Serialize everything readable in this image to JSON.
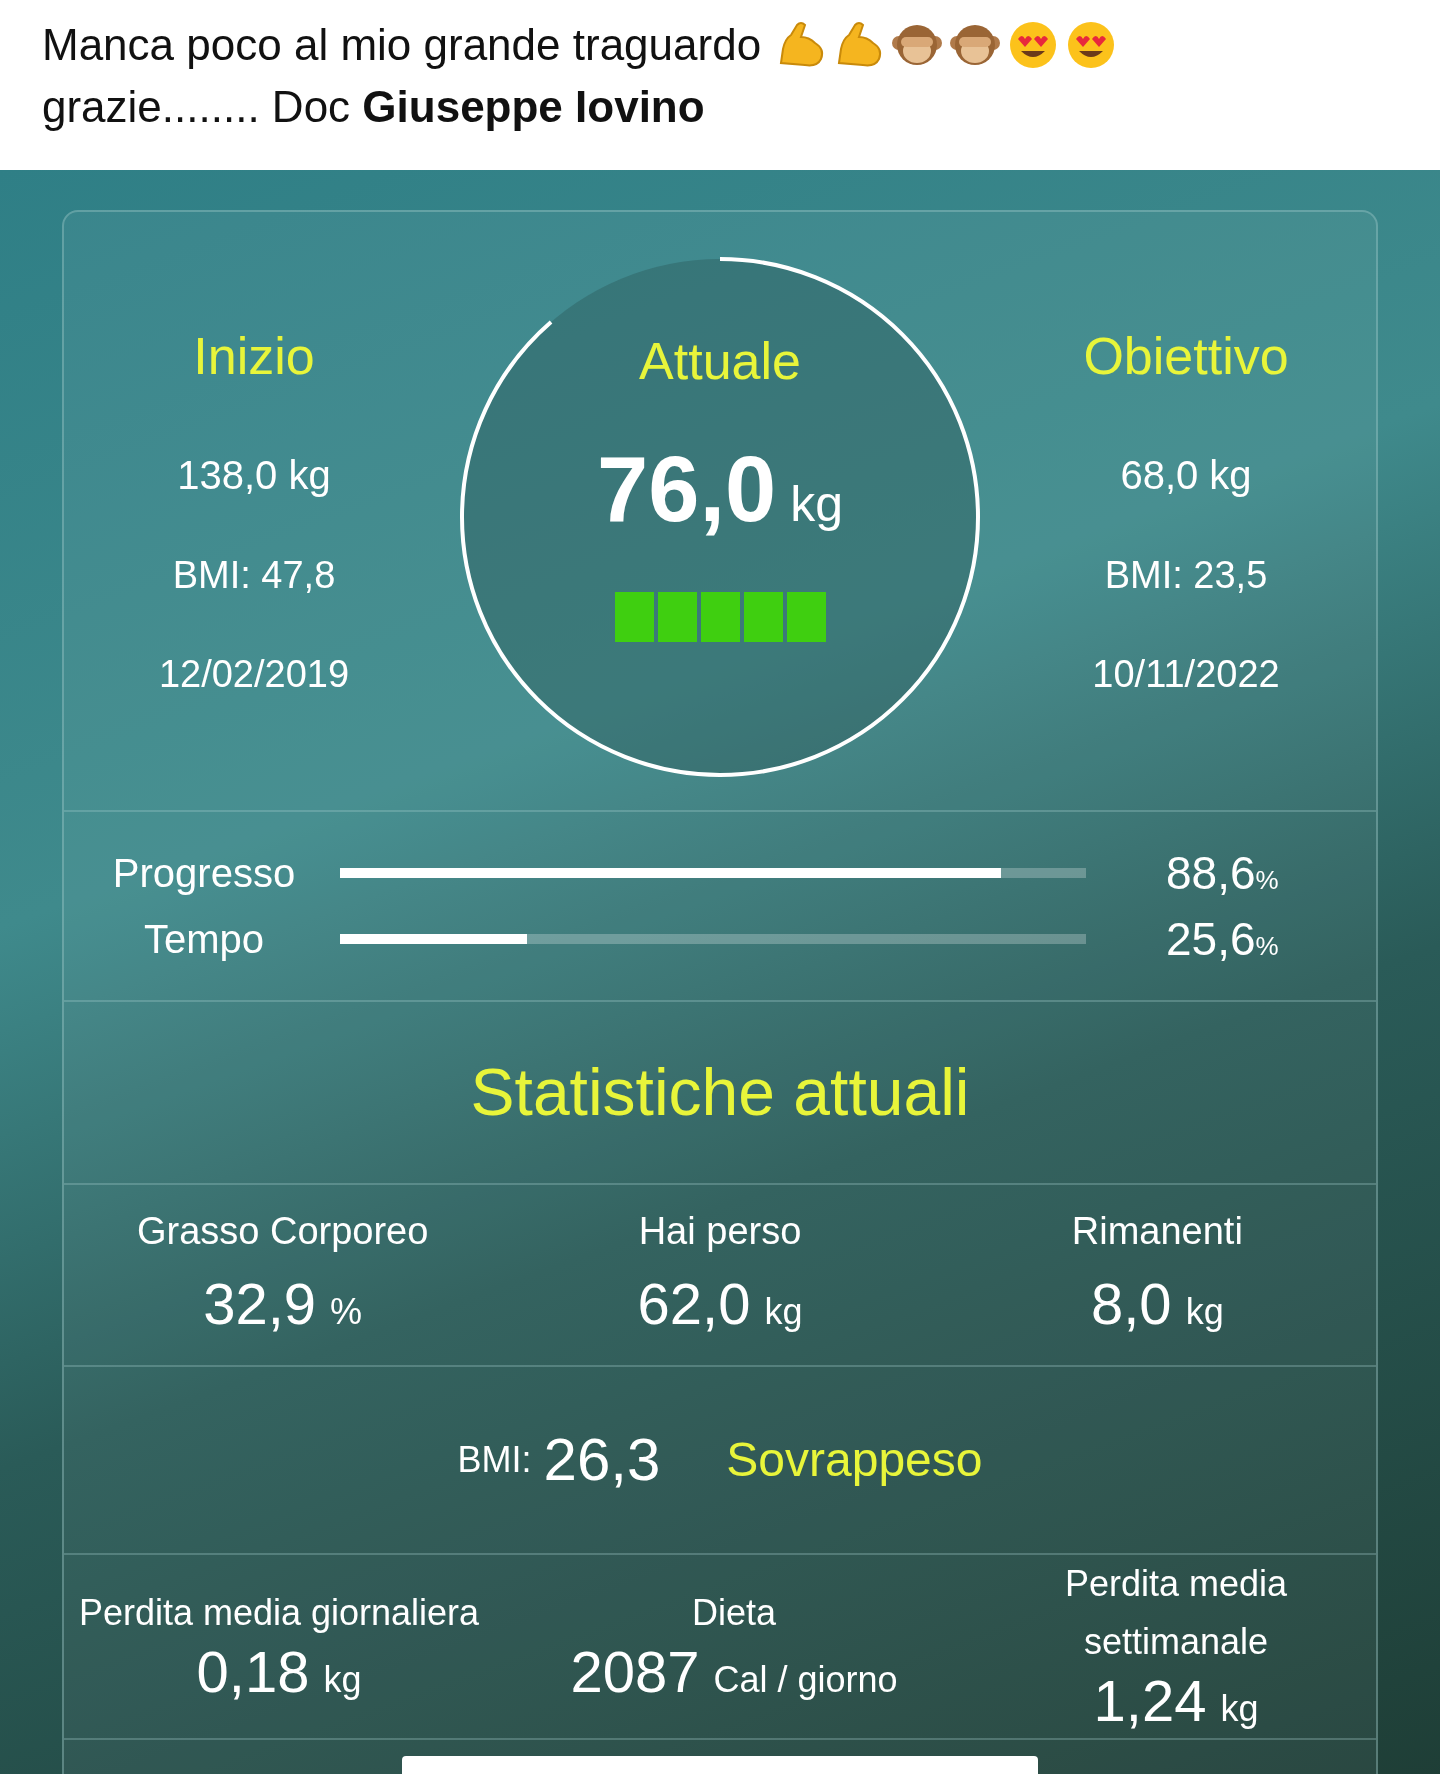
{
  "post": {
    "line_1": "Manca poco al mio grande traguardo",
    "line_2": "grazie........ Doc **Giuseppe Iovino**"
  },
  "summary": {
    "start": {
      "title": "Inizio",
      "weight": "138,0 kg",
      "bmi": "BMI: 47,8",
      "date": "12/02/2019"
    },
    "current": {
      "title": "Attuale",
      "value": "76,0",
      "unit": "kg",
      "level": 1
    },
    "goal": {
      "title": "Obiettivo",
      "weight": "68,0 kg",
      "bmi": "BMI: 23,5",
      "date": "10/11/2022"
    }
  },
  "progress": [
    {
      "label": "Progresso",
      "level": 0.886,
      "value": "88,6",
      "unit": "%"
    },
    {
      "label": "Tempo",
      "level": 0.25,
      "value": "25,6",
      "unit": "%"
    }
  ],
  "stats_title": "Statistiche attuali",
  "stats": [
    {
      "label": "Grasso Corporeo",
      "value": "32,9",
      "unit": "%"
    },
    {
      "label": "Hai perso",
      "value": "62,0",
      "unit": "kg"
    },
    {
      "label": "Rimanenti",
      "value": "8,0",
      "unit": "kg"
    }
  ],
  "bmi": {
    "label": "BMI:",
    "value": "26,3",
    "category": "Sovrappeso"
  },
  "averages": [
    {
      "label": "Perdita media giornaliera",
      "value": "0,18",
      "unit": "kg"
    },
    {
      "label": "Dieta",
      "value": "2087",
      "unit": "Cal / giorno"
    },
    {
      "label": "Perdita media settimanale",
      "value": "1,24",
      "unit": "kg"
    }
  ]
}
